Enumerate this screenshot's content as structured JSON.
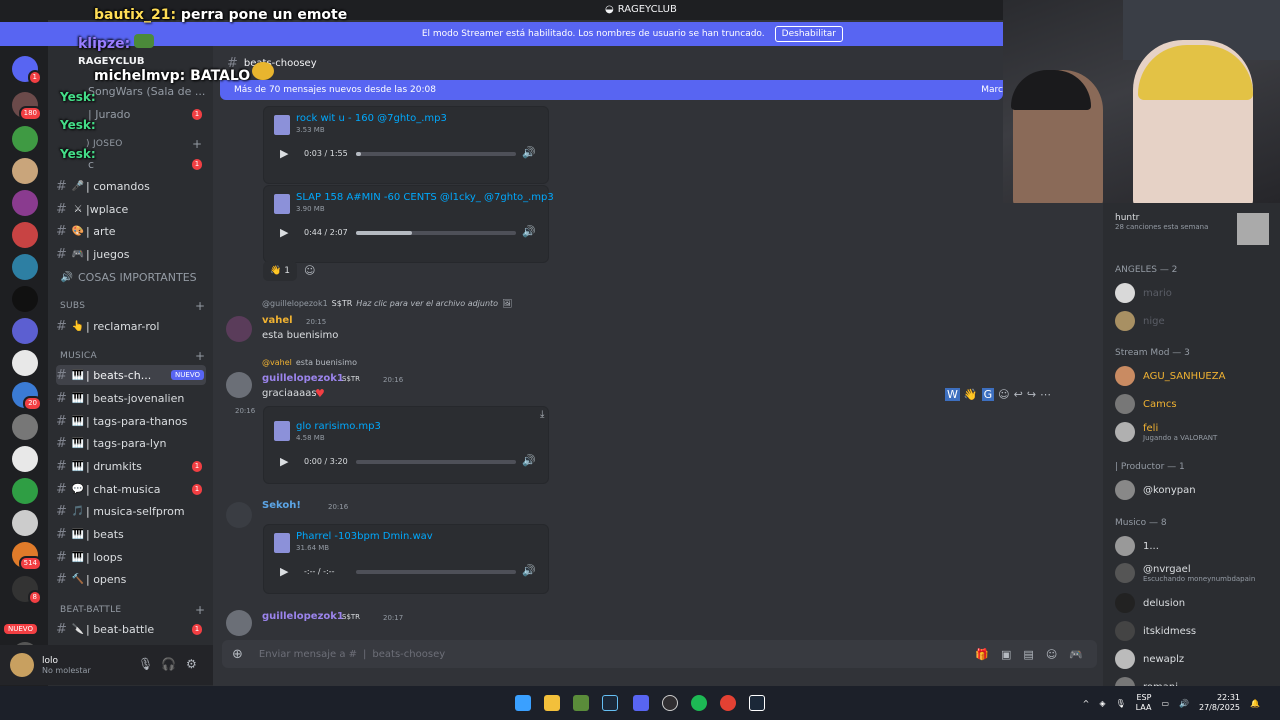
{
  "window": {
    "title": "RAGEYCLUB"
  },
  "streamer_bar": {
    "text": "El modo Streamer está habilitado. Los nombres de usuario se han truncado.",
    "button": "Deshabilitar"
  },
  "channel_header": {
    "name": "beats-choosey"
  },
  "new_messages_banner": {
    "text": "Más de 70 mensajes nuevos desde las 20:08",
    "right": "Marc"
  },
  "overlay_chat": [
    {
      "user": "bautix_21:",
      "text": "perra pone un emote",
      "color": "#ffdd55"
    },
    {
      "user": "klipze:",
      "text": "",
      "color": "#9a7dff"
    },
    {
      "user": "michelmvp:",
      "text": "BATALO",
      "color": "#ffffff"
    },
    {
      "user": "Yesk:",
      "text": "",
      "color": "#44dd88"
    },
    {
      "user": "Yesk:",
      "text": "",
      "color": "#44dd88"
    },
    {
      "user": "Yesk:",
      "text": "",
      "color": "#44dd88"
    }
  ],
  "sidebar": {
    "server_name": "RAGEYCLUB",
    "top_items": [
      {
        "label": "SongWars (Sala de ..."
      },
      {
        "label": "| Jurado",
        "badge": "1"
      },
      {
        "label": ") JOSEO"
      },
      {
        "label": "c",
        "badge": "1"
      }
    ],
    "channels": [
      {
        "label": "| comandos",
        "icon": "🎤"
      },
      {
        "label": "|wplace",
        "icon": "⚔"
      },
      {
        "label": "| arte",
        "icon": "🎨"
      },
      {
        "label": "| juegos",
        "icon": "🎮"
      },
      {
        "label": "COSAS IMPORTANTES",
        "icon": "🔊"
      }
    ],
    "cat_subs": "SUBS",
    "subs_channels": [
      {
        "label": "| reclamar-rol",
        "icon": "👆"
      }
    ],
    "cat_musica": "MUSICA",
    "musica_channels": [
      {
        "label": "| beats-ch...",
        "icon": "🎹",
        "new": "NUEVO"
      },
      {
        "label": "| beats-jovenalien",
        "icon": "🎹"
      },
      {
        "label": "| tags-para-thanos",
        "icon": "🎹"
      },
      {
        "label": "| tags-para-lyn",
        "icon": "🎹"
      },
      {
        "label": "| drumkits",
        "icon": "🎹",
        "badge": "1"
      },
      {
        "label": "| chat-musica",
        "icon": "💬",
        "badge": "1"
      },
      {
        "label": "| musica-selfprom",
        "icon": "🎵"
      },
      {
        "label": "| beats",
        "icon": "🎹"
      },
      {
        "label": "| loops",
        "icon": "🎹"
      },
      {
        "label": "| opens",
        "icon": "🔨"
      }
    ],
    "cat_battle": "BEAT-BATTLE",
    "battle_channels": [
      {
        "label": "| beat-battle",
        "icon": "🔪",
        "badge": "1"
      }
    ]
  },
  "user_panel": {
    "name": "lolo",
    "status": "No molestar"
  },
  "messages": {
    "att1": {
      "name": "rock wit u - 160 @7ghto_.mp3",
      "size": "3.53 MB",
      "time": "0:03 / 1:55",
      "progress": 0.03
    },
    "att2": {
      "name": "SLAP 158 A#MIN -60 CENTS @l1cky_ @7ghto_.mp3",
      "size": "3.90 MB",
      "time": "0:44 / 2:07",
      "progress": 0.35
    },
    "reaction_count": "1",
    "vahel": {
      "reply_user": "@guillelopezok1",
      "reply_tag": "S$TR",
      "reply_text": "Haz clic para ver el archivo adjunto",
      "user": "vahel",
      "time": "20:15",
      "text": "esta buenisimo"
    },
    "guille": {
      "reply_user": "@vahel",
      "reply_text": "esta buenisimo",
      "user": "guillelopezok1",
      "tag": "S$TR",
      "time": "20:16",
      "side_time": "20:16",
      "text": "graciaaaas"
    },
    "att3": {
      "name": "glo rarisimo.mp3",
      "size": "4.58 MB",
      "time": "0:00 / 3:20",
      "progress": 0.0
    },
    "sekoh": {
      "user": "Sekoh!",
      "time": "20:16"
    },
    "att4": {
      "name": "Pharrel -103bpm Dmin.wav",
      "size": "31.64 MB",
      "time": "-:-- / -:--",
      "progress": 0.0
    },
    "guille2": {
      "user": "guillelopezok1",
      "tag": "S$TR",
      "time": "20:17"
    }
  },
  "composer": {
    "placeholder": "Enviar mensaje a #",
    "channel": "beats-choosey"
  },
  "members": {
    "top": {
      "name": "huntr",
      "status": "28 canciones esta semana"
    },
    "groups": [
      {
        "title": "ANGELES — 2",
        "items": [
          {
            "name": "mario",
            "color": "#5a5d66"
          },
          {
            "name": "nige",
            "color": "#5a5d66"
          }
        ]
      },
      {
        "title": "Stream Mod — 3",
        "items": [
          {
            "name": "AGU_SANHUEZA",
            "color": "#f0b232"
          },
          {
            "name": "Camcs",
            "color": "#f0b232"
          },
          {
            "name": "feli",
            "color": "#f0b232",
            "status": "Jugando a VALORANT"
          }
        ]
      },
      {
        "title": "| Productor — 1",
        "items": [
          {
            "name": "@konypan",
            "color": "#dbdee1"
          }
        ]
      },
      {
        "title": "Musico — 8",
        "items": [
          {
            "name": "1...",
            "color": "#dbdee1"
          },
          {
            "name": "@nvrgael",
            "color": "#dbdee1",
            "status": "Escuchando moneynumbdapain"
          },
          {
            "name": "delusion",
            "color": "#dbdee1"
          },
          {
            "name": "itskidmess",
            "color": "#dbdee1"
          },
          {
            "name": "newaplz",
            "color": "#dbdee1"
          },
          {
            "name": "romani",
            "color": "#dbdee1"
          }
        ]
      }
    ]
  },
  "taskbar": {
    "lang": "ESP",
    "lang2": "LAA",
    "time": "22:31",
    "date": "27/8/2025"
  },
  "server_badges": [
    "408",
    "1",
    "180",
    "20",
    "514",
    "8",
    "NUEVO"
  ]
}
